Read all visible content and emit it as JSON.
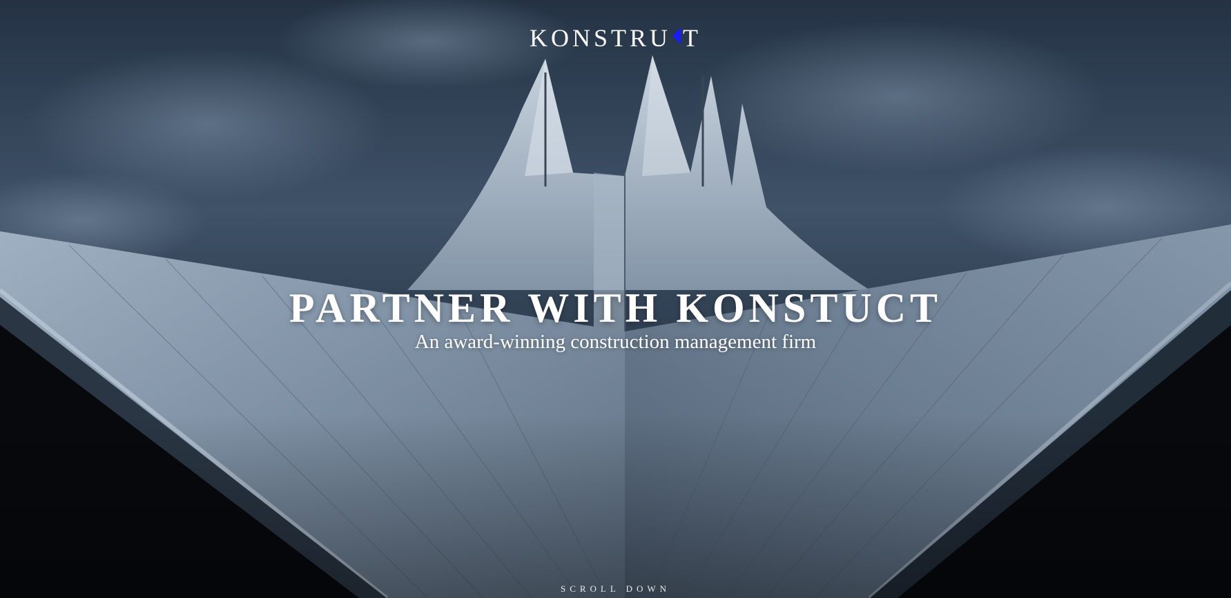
{
  "brand": {
    "logo_before": "KONSTRU",
    "logo_after": "T",
    "logo_mark_icon": "blue-left-triangle",
    "logo_mark_color": "#1a1aff"
  },
  "hero": {
    "headline": "PARTNER WITH KONSTUCT",
    "subtitle": "An award-winning construction management firm",
    "scroll_label": "SCROLL DOWN"
  }
}
